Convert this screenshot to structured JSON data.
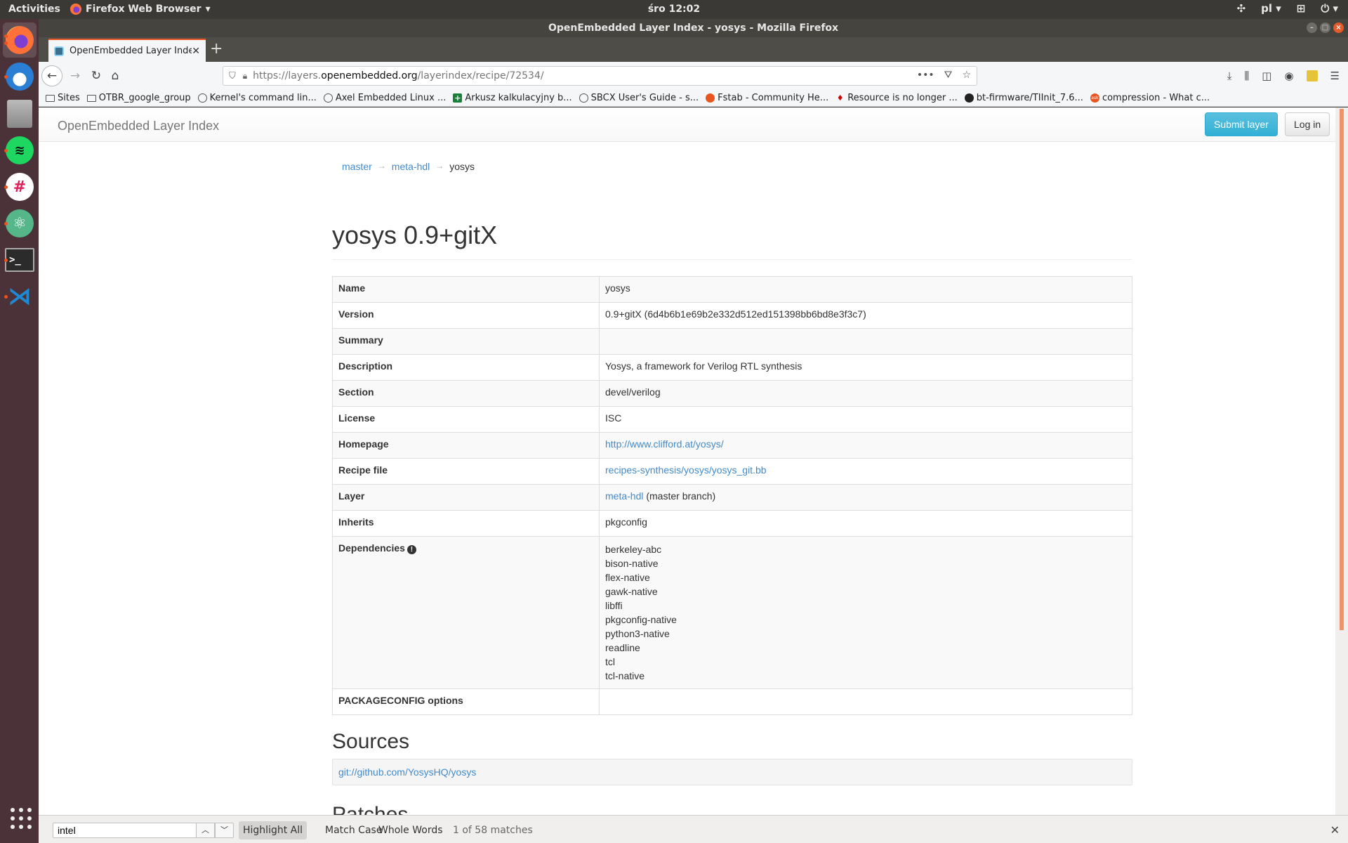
{
  "system": {
    "activities": "Activities",
    "app_menu": "Firefox Web Browser",
    "clock": "śro 12:02",
    "keyboard_layout": "pl"
  },
  "dock": {
    "apps": [
      {
        "name": "firefox",
        "icon": "firefox-icon",
        "color": "#ff7139",
        "active": true
      },
      {
        "name": "thunderbird",
        "icon": "thunderbird-icon",
        "color": "#2a7fd4"
      },
      {
        "name": "files",
        "icon": "file-cabinet-icon",
        "color": "#8a8a8a"
      },
      {
        "name": "spotify",
        "icon": "spotify-icon",
        "color": "#1ed760"
      },
      {
        "name": "slack",
        "icon": "slack-icon",
        "color": "#ffffff"
      },
      {
        "name": "atom",
        "icon": "atom-icon",
        "color": "#55b68a"
      },
      {
        "name": "terminal",
        "icon": "terminal-icon",
        "color": "#2b2b2b"
      },
      {
        "name": "vscode",
        "icon": "vscode-icon",
        "color": "#1f8ad2"
      }
    ]
  },
  "window": {
    "title": "OpenEmbedded Layer Index - yosys - Mozilla Firefox"
  },
  "browser": {
    "tab_title": "OpenEmbedded Layer Index - yosys",
    "url_prefix": "https://layers.",
    "url_domain": "openembedded.org",
    "url_path": "/layerindex/recipe/72534/",
    "bookmarks": [
      {
        "label": "Sites",
        "icon": "folder"
      },
      {
        "label": "OTBR_google_group",
        "icon": "folder"
      },
      {
        "label": "Kernel's command lin...",
        "icon": "globe"
      },
      {
        "label": "Axel Embedded Linux ...",
        "icon": "globe"
      },
      {
        "label": "Arkusz kalkulacyjny b...",
        "icon": "sheet"
      },
      {
        "label": "SBCX User's Guide - s...",
        "icon": "globe"
      },
      {
        "label": "Fstab - Community He...",
        "icon": "ubuntu"
      },
      {
        "label": "Resource is no longer ...",
        "icon": "ti"
      },
      {
        "label": "bt-firmware/TIInit_7.6...",
        "icon": "gh"
      },
      {
        "label": "compression - What c...",
        "icon": "ask"
      }
    ]
  },
  "site": {
    "brand": "OpenEmbedded Layer Index",
    "submit_label": "Submit layer",
    "login_label": "Log in",
    "breadcrumb": [
      "master",
      "meta-hdl",
      "yosys"
    ],
    "breadcrumb_sep": "→",
    "title": "yosys 0.9+gitX",
    "rows": {
      "name": {
        "label": "Name",
        "value": "yosys"
      },
      "version": {
        "label": "Version",
        "value": "0.9+gitX (6d4b6b1e69b2e332d512ed151398bb6bd8e3f3c7)"
      },
      "summary": {
        "label": "Summary",
        "value": ""
      },
      "description": {
        "label": "Description",
        "value": "Yosys, a framework for Verilog RTL synthesis"
      },
      "section": {
        "label": "Section",
        "value": "devel/verilog"
      },
      "license": {
        "label": "License",
        "value": "ISC"
      },
      "homepage": {
        "label": "Homepage",
        "value": "http://www.clifford.at/yosys/"
      },
      "recipe_file": {
        "label": "Recipe file",
        "value": "recipes-synthesis/yosys/yosys_git.bb"
      },
      "layer": {
        "label": "Layer",
        "link": "meta-hdl",
        "suffix": " (master branch)"
      },
      "inherits": {
        "label": "Inherits",
        "value": "pkgconfig"
      },
      "dependencies": {
        "label": "Dependencies",
        "items": [
          "berkeley-abc",
          "bison-native",
          "flex-native",
          "gawk-native",
          "libffi",
          "pkgconfig-native",
          "python3-native",
          "readline",
          "tcl",
          "tcl-native"
        ]
      },
      "packageconfig": {
        "label": "PACKAGECONFIG options",
        "value": ""
      }
    },
    "sources_heading": "Sources",
    "source_url": "git://github.com/YosysHQ/yosys",
    "patches_heading": "Patches"
  },
  "findbar": {
    "query": "intel",
    "highlight_all": "Highlight All",
    "match_case": "Match Case",
    "whole_words": "Whole Words",
    "status": "1 of 58 matches"
  },
  "colors": {
    "link": "#428bca",
    "accent": "#e95420",
    "submit_btn": "#31b0d5"
  }
}
